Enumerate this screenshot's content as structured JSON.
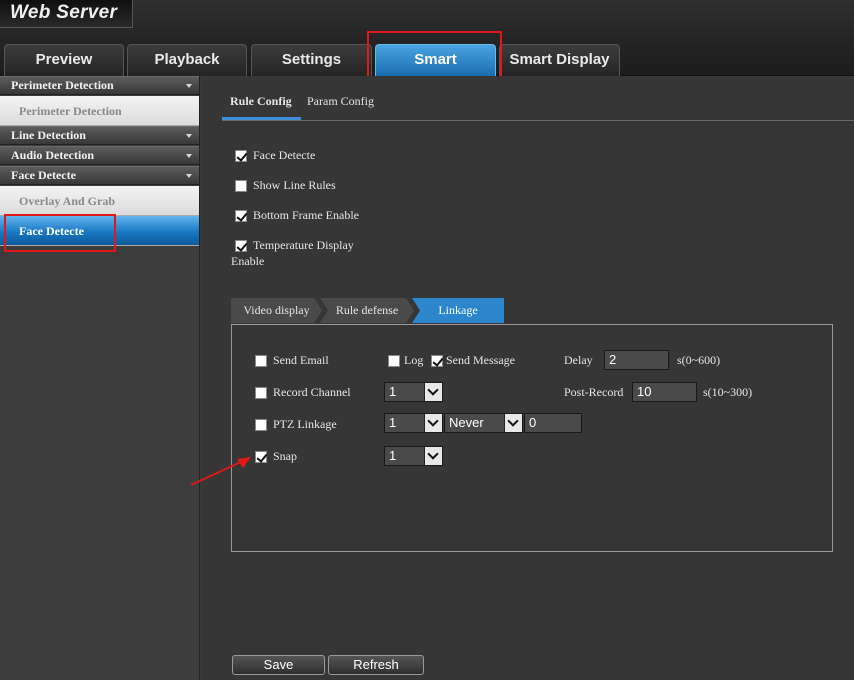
{
  "app": {
    "brand": "Web Server"
  },
  "nav": {
    "tabs": [
      {
        "label": "Preview"
      },
      {
        "label": "Playback"
      },
      {
        "label": "Settings"
      },
      {
        "label": "Smart",
        "active": true
      },
      {
        "label": "Smart Display"
      }
    ]
  },
  "sidebar": {
    "sections": [
      {
        "label": "Perimeter Detection",
        "items": [
          "Perimeter Detection"
        ]
      },
      {
        "label": "Line Detection"
      },
      {
        "label": "Audio Detection"
      },
      {
        "label": "Face Detecte",
        "items": [
          "Overlay And Grab",
          "Face Detecte"
        ],
        "active_item": "Face Detecte"
      }
    ]
  },
  "main": {
    "subtabs": [
      {
        "label": "Rule Config",
        "active": true
      },
      {
        "label": "Param Config"
      }
    ],
    "options": [
      {
        "label": "Face Detecte",
        "checked": true
      },
      {
        "label": "Show Line Rules",
        "checked": false
      },
      {
        "label": "Bottom Frame Enable",
        "checked": true
      },
      {
        "label": "Temperature Display",
        "label_cont": "Enable",
        "checked": true
      }
    ],
    "inner_tabs": [
      {
        "label": "Video display"
      },
      {
        "label": "Rule defense"
      },
      {
        "label": "Linkage",
        "active": true
      }
    ],
    "linkage": {
      "send_email": {
        "label": "Send Email",
        "checked": false
      },
      "log": {
        "label": "Log",
        "checked": false
      },
      "send_message": {
        "label": "Send Message",
        "checked": true
      },
      "delay": {
        "label": "Delay",
        "value": "2",
        "range": "s(0~600)"
      },
      "record_channel": {
        "label": "Record Channel",
        "checked": false,
        "value": "1"
      },
      "post_record": {
        "label": "Post-Record",
        "value": "10",
        "range": "s(10~300)"
      },
      "ptz_linkage": {
        "label": "PTZ Linkage",
        "checked": false,
        "channel": "1",
        "mode": "Never",
        "value": "0"
      },
      "snap": {
        "label": "Snap",
        "checked": true,
        "value": "1"
      }
    },
    "buttons": {
      "save": "Save",
      "refresh": "Refresh"
    }
  },
  "colors": {
    "accent": "#2c86cc",
    "highlight_box": "#e01818",
    "annotation_arrow": "#e01818"
  }
}
